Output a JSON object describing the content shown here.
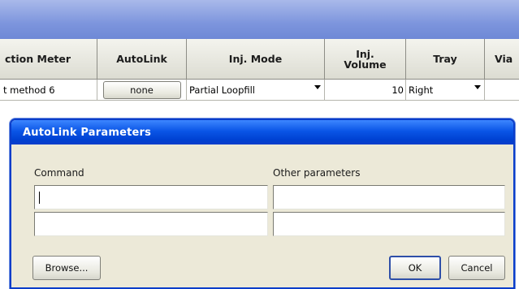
{
  "table": {
    "headers": [
      {
        "label": "ction Meter"
      },
      {
        "label": "AutoLink"
      },
      {
        "label": "Inj. Mode"
      },
      {
        "label": "Inj.\nVolume"
      },
      {
        "label": "Tray"
      },
      {
        "label": "Via"
      }
    ],
    "row": {
      "method": "t method 6",
      "autolink_button": "none",
      "inj_mode": "Partial Loopfill",
      "inj_volume": "10",
      "tray": "Right"
    }
  },
  "dialog": {
    "title": "AutoLink Parameters",
    "command_label": "Command",
    "other_params_label": "Other parameters",
    "command_values": [
      "",
      ""
    ],
    "other_values": [
      "",
      ""
    ],
    "browse_label": "Browse...",
    "ok_label": "OK",
    "cancel_label": "Cancel"
  }
}
